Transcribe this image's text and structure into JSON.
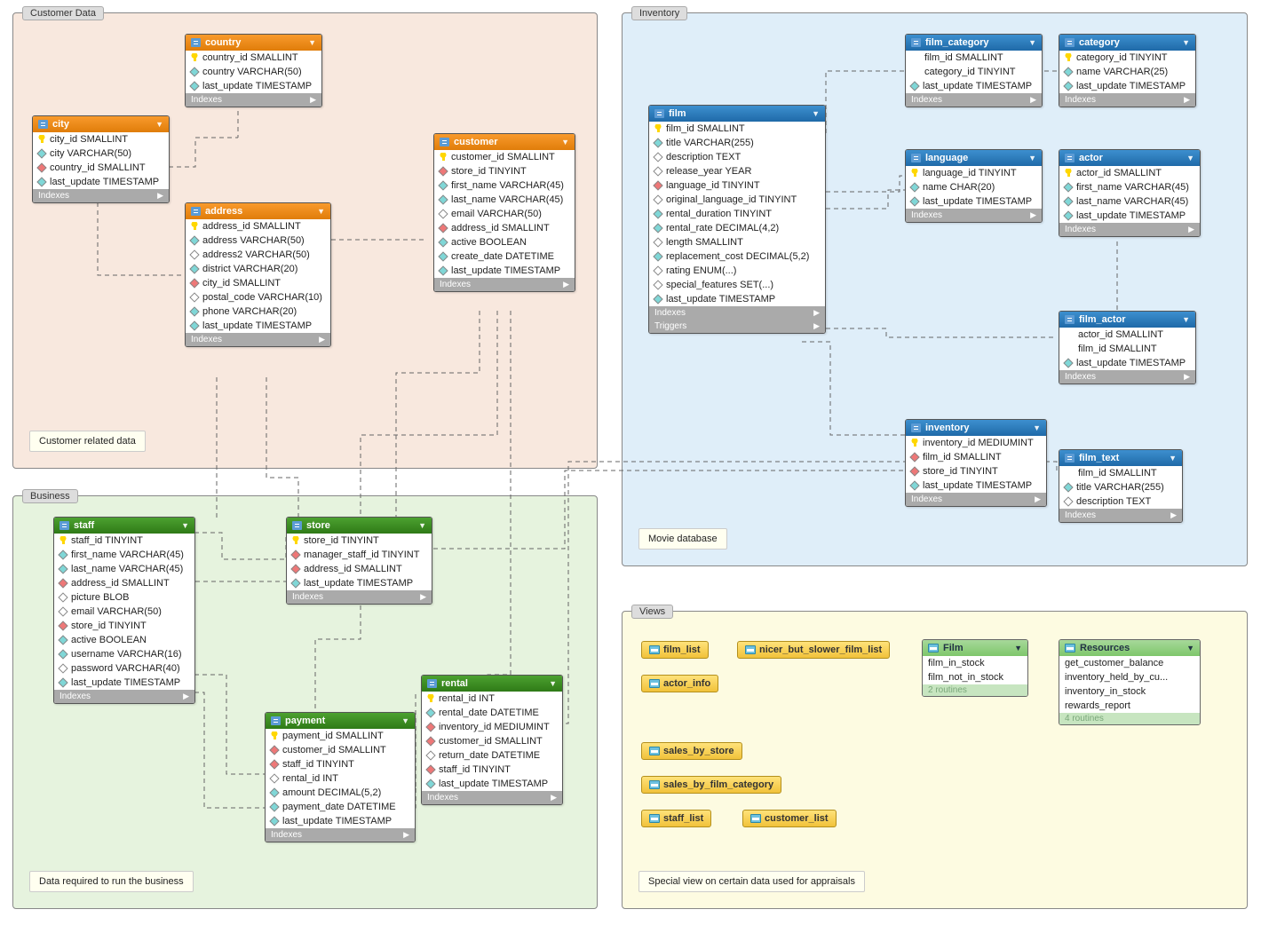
{
  "regions": {
    "customer": {
      "label": "Customer Data",
      "note": "Customer related data"
    },
    "business": {
      "label": "Business",
      "note": "Data required to run the business"
    },
    "inventory": {
      "label": "Inventory",
      "note": "Movie database"
    },
    "views": {
      "label": "Views",
      "note": "Special view on certain data used for appraisals"
    }
  },
  "footers": {
    "indexes": "Indexes",
    "triggers": "Triggers"
  },
  "tables": {
    "country": {
      "title": "country",
      "cols": [
        {
          "icon": "key",
          "text": "country_id SMALLINT"
        },
        {
          "icon": "cyan",
          "text": "country VARCHAR(50)"
        },
        {
          "icon": "cyan",
          "text": "last_update TIMESTAMP"
        }
      ]
    },
    "city": {
      "title": "city",
      "cols": [
        {
          "icon": "key",
          "text": "city_id SMALLINT"
        },
        {
          "icon": "cyan",
          "text": "city VARCHAR(50)"
        },
        {
          "icon": "red",
          "text": "country_id SMALLINT"
        },
        {
          "icon": "cyan",
          "text": "last_update TIMESTAMP"
        }
      ]
    },
    "address": {
      "title": "address",
      "cols": [
        {
          "icon": "key",
          "text": "address_id SMALLINT"
        },
        {
          "icon": "cyan",
          "text": "address VARCHAR(50)"
        },
        {
          "icon": "hollow",
          "text": "address2 VARCHAR(50)"
        },
        {
          "icon": "cyan",
          "text": "district VARCHAR(20)"
        },
        {
          "icon": "red",
          "text": "city_id SMALLINT"
        },
        {
          "icon": "hollow",
          "text": "postal_code VARCHAR(10)"
        },
        {
          "icon": "cyan",
          "text": "phone VARCHAR(20)"
        },
        {
          "icon": "cyan",
          "text": "last_update TIMESTAMP"
        }
      ]
    },
    "customer": {
      "title": "customer",
      "cols": [
        {
          "icon": "key",
          "text": "customer_id SMALLINT"
        },
        {
          "icon": "red",
          "text": "store_id TINYINT"
        },
        {
          "icon": "cyan",
          "text": "first_name VARCHAR(45)"
        },
        {
          "icon": "cyan",
          "text": "last_name VARCHAR(45)"
        },
        {
          "icon": "hollow",
          "text": "email VARCHAR(50)"
        },
        {
          "icon": "red",
          "text": "address_id SMALLINT"
        },
        {
          "icon": "cyan",
          "text": "active BOOLEAN"
        },
        {
          "icon": "cyan",
          "text": "create_date DATETIME"
        },
        {
          "icon": "cyan",
          "text": "last_update TIMESTAMP"
        }
      ]
    },
    "staff": {
      "title": "staff",
      "cols": [
        {
          "icon": "key",
          "text": "staff_id TINYINT"
        },
        {
          "icon": "cyan",
          "text": "first_name VARCHAR(45)"
        },
        {
          "icon": "cyan",
          "text": "last_name VARCHAR(45)"
        },
        {
          "icon": "red",
          "text": "address_id SMALLINT"
        },
        {
          "icon": "hollow",
          "text": "picture BLOB"
        },
        {
          "icon": "hollow",
          "text": "email VARCHAR(50)"
        },
        {
          "icon": "red",
          "text": "store_id TINYINT"
        },
        {
          "icon": "cyan",
          "text": "active BOOLEAN"
        },
        {
          "icon": "cyan",
          "text": "username VARCHAR(16)"
        },
        {
          "icon": "hollow",
          "text": "password VARCHAR(40)"
        },
        {
          "icon": "cyan",
          "text": "last_update TIMESTAMP"
        }
      ]
    },
    "store": {
      "title": "store",
      "cols": [
        {
          "icon": "key",
          "text": "store_id TINYINT"
        },
        {
          "icon": "red",
          "text": "manager_staff_id TINYINT"
        },
        {
          "icon": "red",
          "text": "address_id SMALLINT"
        },
        {
          "icon": "cyan",
          "text": "last_update TIMESTAMP"
        }
      ]
    },
    "payment": {
      "title": "payment",
      "cols": [
        {
          "icon": "key",
          "text": "payment_id SMALLINT"
        },
        {
          "icon": "red",
          "text": "customer_id SMALLINT"
        },
        {
          "icon": "red",
          "text": "staff_id TINYINT"
        },
        {
          "icon": "hollow",
          "text": "rental_id INT"
        },
        {
          "icon": "cyan",
          "text": "amount DECIMAL(5,2)"
        },
        {
          "icon": "cyan",
          "text": "payment_date DATETIME"
        },
        {
          "icon": "cyan",
          "text": "last_update TIMESTAMP"
        }
      ]
    },
    "rental": {
      "title": "rental",
      "cols": [
        {
          "icon": "key",
          "text": "rental_id INT"
        },
        {
          "icon": "cyan",
          "text": "rental_date DATETIME"
        },
        {
          "icon": "red",
          "text": "inventory_id MEDIUMINT"
        },
        {
          "icon": "red",
          "text": "customer_id SMALLINT"
        },
        {
          "icon": "hollow",
          "text": "return_date DATETIME"
        },
        {
          "icon": "red",
          "text": "staff_id TINYINT"
        },
        {
          "icon": "cyan",
          "text": "last_update TIMESTAMP"
        }
      ]
    },
    "film": {
      "title": "film",
      "cols": [
        {
          "icon": "key",
          "text": "film_id SMALLINT"
        },
        {
          "icon": "cyan",
          "text": "title VARCHAR(255)"
        },
        {
          "icon": "hollow",
          "text": "description TEXT"
        },
        {
          "icon": "hollow",
          "text": "release_year YEAR"
        },
        {
          "icon": "red",
          "text": "language_id TINYINT"
        },
        {
          "icon": "hollow",
          "text": "original_language_id TINYINT"
        },
        {
          "icon": "cyan",
          "text": "rental_duration TINYINT"
        },
        {
          "icon": "cyan",
          "text": "rental_rate DECIMAL(4,2)"
        },
        {
          "icon": "hollow",
          "text": "length SMALLINT"
        },
        {
          "icon": "cyan",
          "text": "replacement_cost DECIMAL(5,2)"
        },
        {
          "icon": "hollow",
          "text": "rating ENUM(...)"
        },
        {
          "icon": "hollow",
          "text": "special_features SET(...)"
        },
        {
          "icon": "cyan",
          "text": "last_update TIMESTAMP"
        }
      ]
    },
    "film_category": {
      "title": "film_category",
      "cols": [
        {
          "icon": "none",
          "text": "film_id SMALLINT"
        },
        {
          "icon": "none",
          "text": "category_id TINYINT"
        },
        {
          "icon": "cyan",
          "text": "last_update TIMESTAMP"
        }
      ]
    },
    "category": {
      "title": "category",
      "cols": [
        {
          "icon": "key",
          "text": "category_id TINYINT"
        },
        {
          "icon": "cyan",
          "text": "name VARCHAR(25)"
        },
        {
          "icon": "cyan",
          "text": "last_update TIMESTAMP"
        }
      ]
    },
    "language": {
      "title": "language",
      "cols": [
        {
          "icon": "key",
          "text": "language_id TINYINT"
        },
        {
          "icon": "cyan",
          "text": "name CHAR(20)"
        },
        {
          "icon": "cyan",
          "text": "last_update TIMESTAMP"
        }
      ]
    },
    "actor": {
      "title": "actor",
      "cols": [
        {
          "icon": "key",
          "text": "actor_id SMALLINT"
        },
        {
          "icon": "cyan",
          "text": "first_name VARCHAR(45)"
        },
        {
          "icon": "cyan",
          "text": "last_name VARCHAR(45)"
        },
        {
          "icon": "cyan",
          "text": "last_update TIMESTAMP"
        }
      ]
    },
    "film_actor": {
      "title": "film_actor",
      "cols": [
        {
          "icon": "none",
          "text": "actor_id SMALLINT"
        },
        {
          "icon": "none",
          "text": "film_id SMALLINT"
        },
        {
          "icon": "cyan",
          "text": "last_update TIMESTAMP"
        }
      ]
    },
    "inventory": {
      "title": "inventory",
      "cols": [
        {
          "icon": "key",
          "text": "inventory_id MEDIUMINT"
        },
        {
          "icon": "red",
          "text": "film_id SMALLINT"
        },
        {
          "icon": "red",
          "text": "store_id TINYINT"
        },
        {
          "icon": "cyan",
          "text": "last_update TIMESTAMP"
        }
      ]
    },
    "film_text": {
      "title": "film_text",
      "cols": [
        {
          "icon": "none",
          "text": "film_id SMALLINT"
        },
        {
          "icon": "cyan",
          "text": "title VARCHAR(255)"
        },
        {
          "icon": "hollow",
          "text": "description TEXT"
        }
      ]
    }
  },
  "views": {
    "pills": [
      "film_list",
      "nicer_but_slower_film_list",
      "actor_info",
      "sales_by_store",
      "sales_by_film_category",
      "staff_list",
      "customer_list"
    ],
    "routines": {
      "film": {
        "title": "Film",
        "rows": [
          "film_in_stock",
          "film_not_in_stock"
        ],
        "footer": "2 routines"
      },
      "resources": {
        "title": "Resources",
        "rows": [
          "get_customer_balance",
          "inventory_held_by_cu...",
          "inventory_in_stock",
          "rewards_report"
        ],
        "footer": "4 routines"
      }
    }
  }
}
